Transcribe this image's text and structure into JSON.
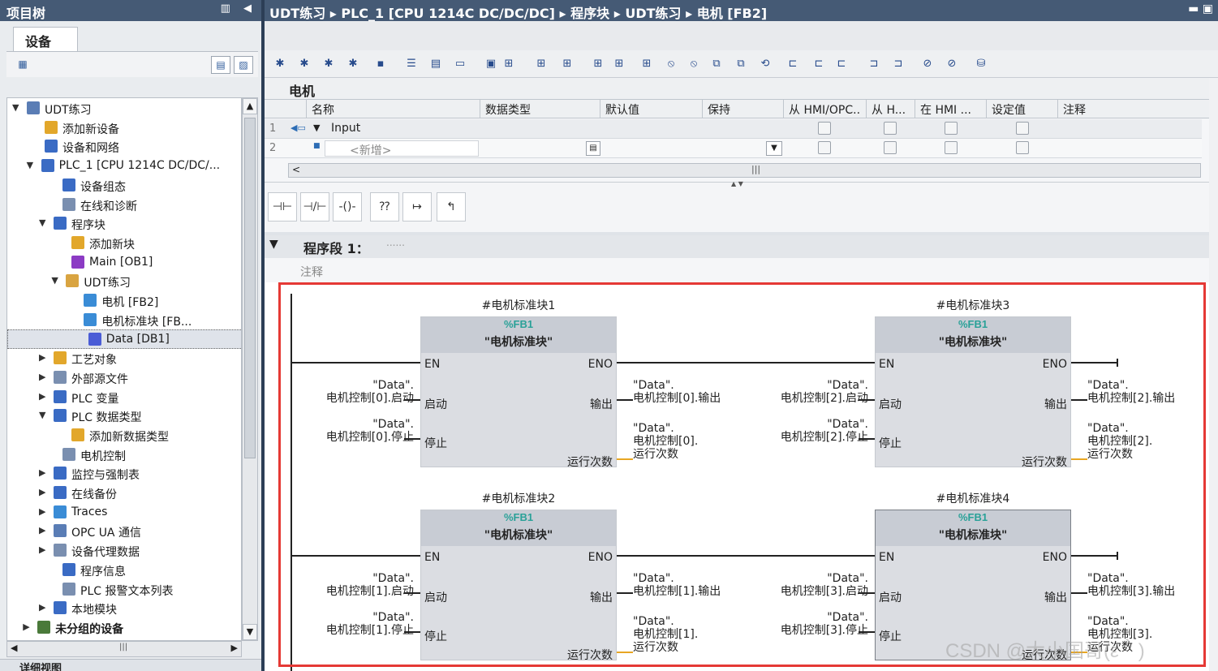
{
  "left_panel": {
    "title": "项目树",
    "tab": "设备",
    "footer": "详细视图",
    "tree": [
      {
        "label": "UDT练习",
        "icon": "project-icon"
      },
      {
        "label": "添加新设备",
        "icon": "add-device-icon"
      },
      {
        "label": "设备和网络",
        "icon": "network-icon"
      },
      {
        "label": "PLC_1 [CPU 1214C DC/DC/...",
        "icon": "plc-icon"
      },
      {
        "label": "设备组态",
        "icon": "device-config-icon"
      },
      {
        "label": "在线和诊断",
        "icon": "diagnostics-icon"
      },
      {
        "label": "程序块",
        "icon": "program-blocks-icon"
      },
      {
        "label": "添加新块",
        "icon": "add-block-icon"
      },
      {
        "label": "Main [OB1]",
        "icon": "ob-icon"
      },
      {
        "label": "UDT练习",
        "icon": "folder-icon"
      },
      {
        "label": "电机 [FB2]",
        "icon": "fb-icon"
      },
      {
        "label": "电机标准块 [FB...",
        "icon": "fb-icon"
      },
      {
        "label": "Data [DB1]",
        "icon": "db-icon"
      },
      {
        "label": "工艺对象",
        "icon": "tech-object-icon"
      },
      {
        "label": "外部源文件",
        "icon": "source-file-icon"
      },
      {
        "label": "PLC 变量",
        "icon": "plc-tags-icon"
      },
      {
        "label": "PLC 数据类型",
        "icon": "datatype-icon"
      },
      {
        "label": "添加新数据类型",
        "icon": "add-datatype-icon"
      },
      {
        "label": "电机控制",
        "icon": "udt-icon"
      },
      {
        "label": "监控与强制表",
        "icon": "watch-table-icon"
      },
      {
        "label": "在线备份",
        "icon": "backup-icon"
      },
      {
        "label": "Traces",
        "icon": "traces-icon"
      },
      {
        "label": "OPC UA 通信",
        "icon": "opcua-icon"
      },
      {
        "label": "设备代理数据",
        "icon": "proxy-icon"
      },
      {
        "label": "程序信息",
        "icon": "program-info-icon"
      },
      {
        "label": "PLC 报警文本列表",
        "icon": "alarm-text-icon"
      },
      {
        "label": "本地模块",
        "icon": "local-modules-icon"
      },
      {
        "label": "未分组的设备",
        "icon": "ungrouped-icon"
      }
    ]
  },
  "editor": {
    "breadcrumb": "UDT练习 ▸ PLC_1 [CPU 1214C DC/DC/DC] ▸ 程序块 ▸ UDT练习 ▸ 电机 [FB2]",
    "block_title": "电机",
    "table_headers": [
      "名称",
      "数据类型",
      "默认值",
      "保持",
      "从 HMI/OPC..",
      "从 H...",
      "在 HMI ...",
      "设定值",
      "注释"
    ],
    "rows": [
      {
        "num": "1",
        "name": "Input"
      },
      {
        "num": "2",
        "name": "<新增>"
      }
    ],
    "hscroll_mark": "|||",
    "segment_title": "程序段 1：",
    "segment_dots": "......",
    "comment_placeholder": "注释"
  },
  "network": {
    "blocks": [
      {
        "instance": "#电机标准块1",
        "fb": "%FB1",
        "name": "\"电机标准块\"",
        "in1a": "\"Data\".",
        "in1b": "电机控制[0].启动",
        "in2a": "\"Data\".",
        "in2b": "电机控制[0].停止",
        "out1a": "\"Data\".",
        "out1b": "电机控制[0].输出",
        "out2a": "\"Data\".",
        "out2b": "电机控制[0].",
        "out2c": "运行次数"
      },
      {
        "instance": "#电机标准块3",
        "fb": "%FB1",
        "name": "\"电机标准块\"",
        "in1a": "\"Data\".",
        "in1b": "电机控制[2].启动",
        "in2a": "\"Data\".",
        "in2b": "电机控制[2].停止",
        "out1a": "\"Data\".",
        "out1b": "电机控制[2].输出",
        "out2a": "\"Data\".",
        "out2b": "电机控制[2].",
        "out2c": "运行次数"
      },
      {
        "instance": "#电机标准块2",
        "fb": "%FB1",
        "name": "\"电机标准块\"",
        "in1a": "\"Data\".",
        "in1b": "电机控制[1].启动",
        "in2a": "\"Data\".",
        "in2b": "电机控制[1].停止",
        "out1a": "\"Data\".",
        "out1b": "电机控制[1].输出",
        "out2a": "\"Data\".",
        "out2b": "电机控制[1].",
        "out2c": "运行次数"
      },
      {
        "instance": "#电机标准块4",
        "fb": "%FB1",
        "name": "\"电机标准块\"",
        "in1a": "\"Data\".",
        "in1b": "电机控制[3].启动",
        "in2a": "\"Data\".",
        "in2b": "电机控制[3].停止",
        "out1a": "\"Data\".",
        "out1b": "电机控制[3].输出",
        "out2a": "\"Data\".",
        "out2b": "电机控制[3].",
        "out2c": "运行次数"
      }
    ],
    "pins": {
      "en": "EN",
      "eno": "ENO",
      "start": "启动",
      "stop": "停止",
      "output": "输出",
      "count": "运行次数"
    }
  },
  "watermark": "CSDN @大小国哥(ε｀)",
  "colors": {
    "header": "#455a75",
    "highlight": "#e53935",
    "fb_label": "#2aa198",
    "count_wire": "#e8a623"
  }
}
